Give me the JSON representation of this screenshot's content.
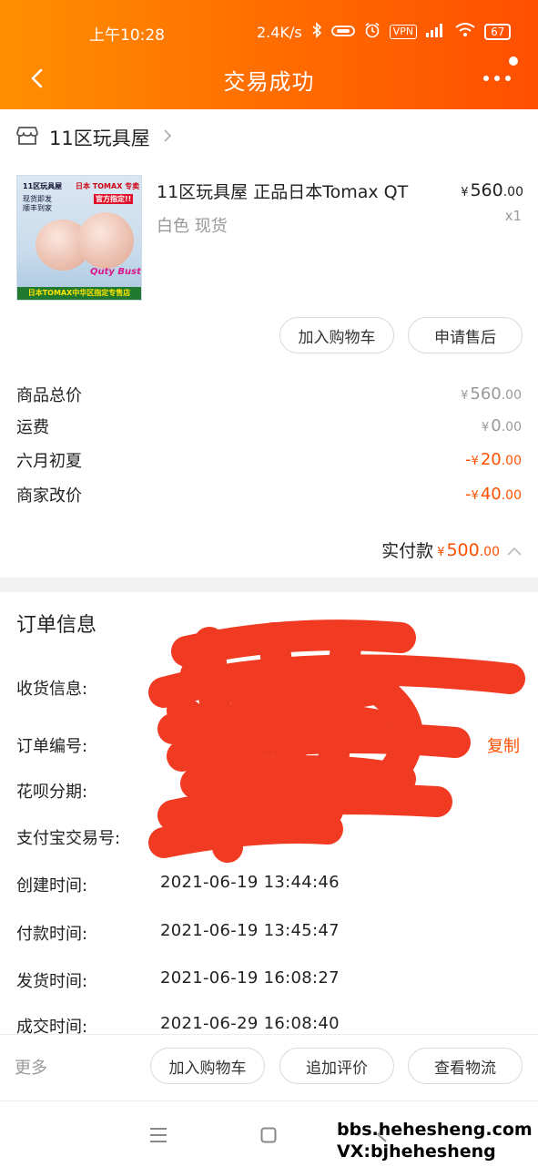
{
  "status_bar": {
    "time": "上午10:28",
    "network_speed": "2.4K/s",
    "vpn_badge": "VPN",
    "battery": "67"
  },
  "nav": {
    "title": "交易成功"
  },
  "store": {
    "name": "11区玩具屋"
  },
  "product": {
    "title": "11区玩具屋 正品日本Tomax QT",
    "spec": "白色 现货",
    "price_currency": "¥",
    "price_int": "560",
    "price_dec": ".00",
    "quantity": "x1",
    "image_text": {
      "store": "11区玩具屋",
      "brand": "日本 TOMAX 专卖",
      "ship1": "现货即发",
      "ship2": "顺丰到家",
      "official": "官方指定!!",
      "logo": "Quty Bust",
      "footer": "日本TOMAX中华区指定专售店"
    }
  },
  "actions": {
    "add_cart": "加入购物车",
    "after_sale": "申请售后"
  },
  "fees": [
    {
      "label": "商品总价",
      "prefix": "",
      "currency": "¥",
      "int": "560",
      "dec": ".00",
      "highlight": false
    },
    {
      "label": "运费",
      "prefix": "",
      "currency": "¥",
      "int": "0",
      "dec": ".00",
      "highlight": false
    },
    {
      "label": "六月初夏",
      "prefix": "-",
      "currency": "¥",
      "int": "20",
      "dec": ".00",
      "highlight": true
    },
    {
      "label": "商家改价",
      "prefix": "-",
      "currency": "¥",
      "int": "40",
      "dec": ".00",
      "highlight": true
    }
  ],
  "paid": {
    "label": "实付款",
    "currency": "¥",
    "int": "500",
    "dec": ".00"
  },
  "order": {
    "section_title": "订单信息",
    "copy_label": "复制",
    "rows": [
      {
        "label": "收货信息:",
        "value": ""
      },
      {
        "label": "订单编号:",
        "value": ""
      },
      {
        "label": "花呗分期:",
        "value": ""
      },
      {
        "label": "支付宝交易号:",
        "value": ""
      },
      {
        "label": "创建时间:",
        "value": "2021-06-19 13:44:46"
      },
      {
        "label": "付款时间:",
        "value": "2021-06-19 13:45:47"
      },
      {
        "label": "发货时间:",
        "value": "2021-06-19 16:08:27"
      },
      {
        "label": "成交时间:",
        "value": "2021-06-29 16:08:40"
      }
    ]
  },
  "bottom_bar": {
    "more": "更多",
    "add_cart": "加入购物车",
    "review": "追加评价",
    "logistics": "查看物流"
  },
  "watermark": {
    "line1": "bbs.hehesheng.com",
    "line2": "VX:bjhehesheng"
  },
  "colors": {
    "accent": "#ff5000",
    "header_start": "#ff8f00",
    "header_end": "#ff4f00"
  }
}
